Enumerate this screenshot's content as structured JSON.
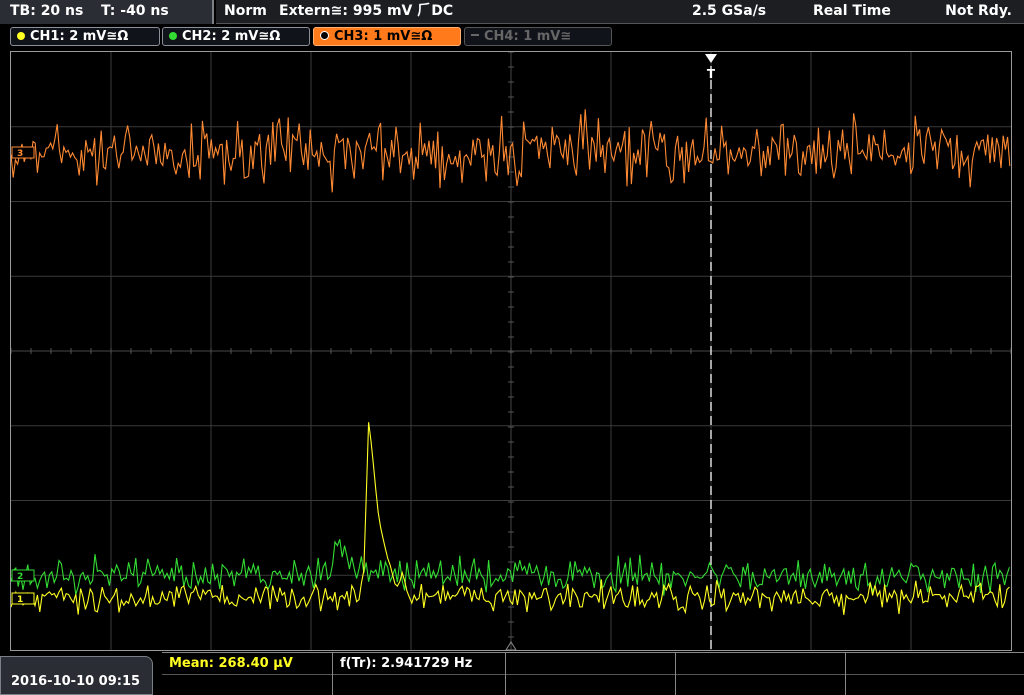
{
  "status": {
    "timebase": "TB: 20 ns",
    "trigger_time": "T: -40 ns",
    "mode": "Norm",
    "trigger_source": "Extern≅: 995 mV ⺁DC",
    "sample_rate": "2.5 GSa/s",
    "acq_mode": "Real Time",
    "ready_state": "Not Rdy."
  },
  "channels": [
    {
      "label": "CH1: 2 mV≅Ω",
      "color": "#ffff22",
      "active": true
    },
    {
      "label": "CH2: 2 mV≅Ω",
      "color": "#33dd33",
      "active": true
    },
    {
      "label": "CH3: 1 mV≅Ω",
      "color": "#ff7a1a",
      "active": true,
      "selected": true
    },
    {
      "label": "CH4: 1 mV≅",
      "color": "#666666",
      "active": false
    }
  ],
  "markers": {
    "ch3": "3",
    "ch2": "2",
    "ch1": "1",
    "trigger": "T"
  },
  "measurements": {
    "mean": "Mean: 268.40 µV",
    "freq": "f(Tr): 2.941729 Hz"
  },
  "datetime": "2016-10-10 09:15",
  "colors": {
    "ch1": "#ffff22",
    "ch2": "#33dd33",
    "ch3": "#ff8a33",
    "grid": "#3a3a3a",
    "trigger_line": "#ffffff"
  }
}
